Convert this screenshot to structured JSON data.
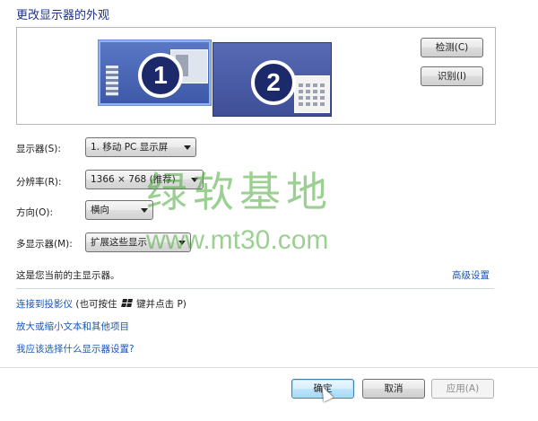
{
  "page_title": "更改显示器的外观",
  "preview": {
    "monitor1_number": "1",
    "monitor2_number": "2",
    "detect_label": "检测(C)",
    "identify_label": "识别(I)"
  },
  "settings": {
    "display_label": "显示器(S):",
    "display_value": "1. 移动 PC 显示屏",
    "resolution_label": "分辨率(R):",
    "resolution_value": "1366 × 768 (推荐)",
    "orientation_label": "方向(O):",
    "orientation_value": "横向",
    "multi_display_label": "多显示器(M):",
    "multi_display_value": "扩展这些显示"
  },
  "status": {
    "main_display_text": "这是您当前的主显示器。",
    "advanced_link": "高级设置"
  },
  "links": {
    "projector_link": "连接到投影仪",
    "projector_hint_before": "(也可按住",
    "projector_hint_after": "键并点击 P)",
    "text_size_link": "放大或缩小文本和其他项目",
    "help_link": "我应该选择什么显示器设置?"
  },
  "buttons": {
    "ok": "确定",
    "cancel": "取消",
    "apply": "应用(A)"
  },
  "watermark": {
    "chinese": "绿软基地",
    "url": "www.mt30.com"
  },
  "icons": {
    "windows_key": "windows-logo-icon",
    "combo_arrow": "chevron-down-icon",
    "pointer": "mouse-cursor-icon"
  },
  "colors": {
    "link": "#1a57b5",
    "title": "#1e3287",
    "watermark": "#4caa3c"
  }
}
